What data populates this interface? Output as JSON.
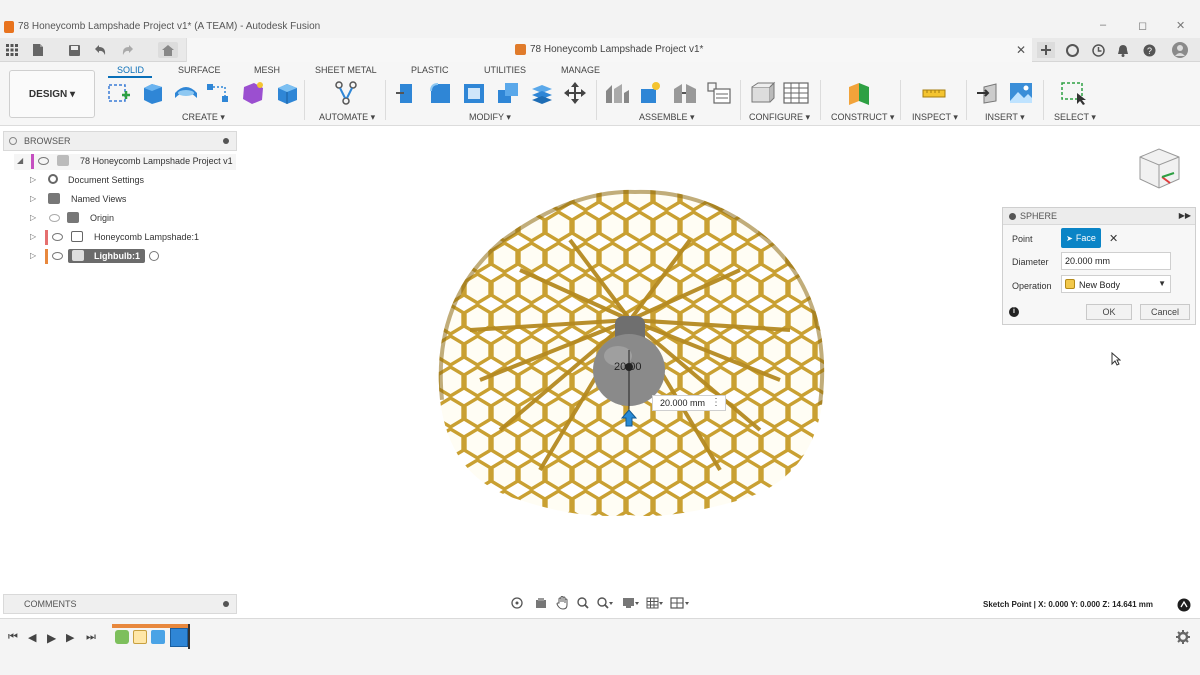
{
  "window": {
    "title": "78 Honeycomb Lampshade Project v1* (A TEAM) - Autodesk Fusion",
    "controls": [
      "–",
      "◻",
      "✕"
    ]
  },
  "doc_tab": {
    "label": "78 Honeycomb Lampshade Project v1*"
  },
  "ribbon": {
    "mode_button": "DESIGN ▾",
    "tabs": [
      "SOLID",
      "SURFACE",
      "MESH",
      "SHEET METAL",
      "PLASTIC",
      "UTILITIES",
      "MANAGE"
    ],
    "groups": [
      "CREATE ▾",
      "AUTOMATE ▾",
      "MODIFY ▾",
      "ASSEMBLE ▾",
      "CONFIGURE ▾",
      "CONSTRUCT ▾",
      "INSPECT ▾",
      "INSERT ▾",
      "SELECT ▾"
    ]
  },
  "browser": {
    "title": "BROWSER",
    "items": [
      {
        "label": "78 Honeycomb Lampshade Project v1"
      },
      {
        "label": "Document Settings"
      },
      {
        "label": "Named Views"
      },
      {
        "label": "Origin"
      },
      {
        "label": "Honeycomb Lampshade:1"
      },
      {
        "label": "Lighbulb:1"
      }
    ]
  },
  "comments": {
    "title": "COMMENTS"
  },
  "sphere_dialog": {
    "title": "SPHERE",
    "point_label": "Point",
    "face_button": "Face",
    "diameter_label": "Diameter",
    "diameter_value": "20.000 mm",
    "operation_label": "Operation",
    "operation_value": "New Body",
    "ok": "OK",
    "cancel": "Cancel"
  },
  "viewport": {
    "dimension_text": "20.00",
    "dimension_input": "20.000 mm"
  },
  "status_bar": {
    "text": "Sketch Point | X: 0.000 Y: 0.000 Z: 14.641 mm"
  },
  "colors": {
    "accent": "#0a84c6",
    "lampshade": "#c9a032",
    "lampshade_dark": "#8e6b15",
    "bulb": "#7d7d7d"
  }
}
